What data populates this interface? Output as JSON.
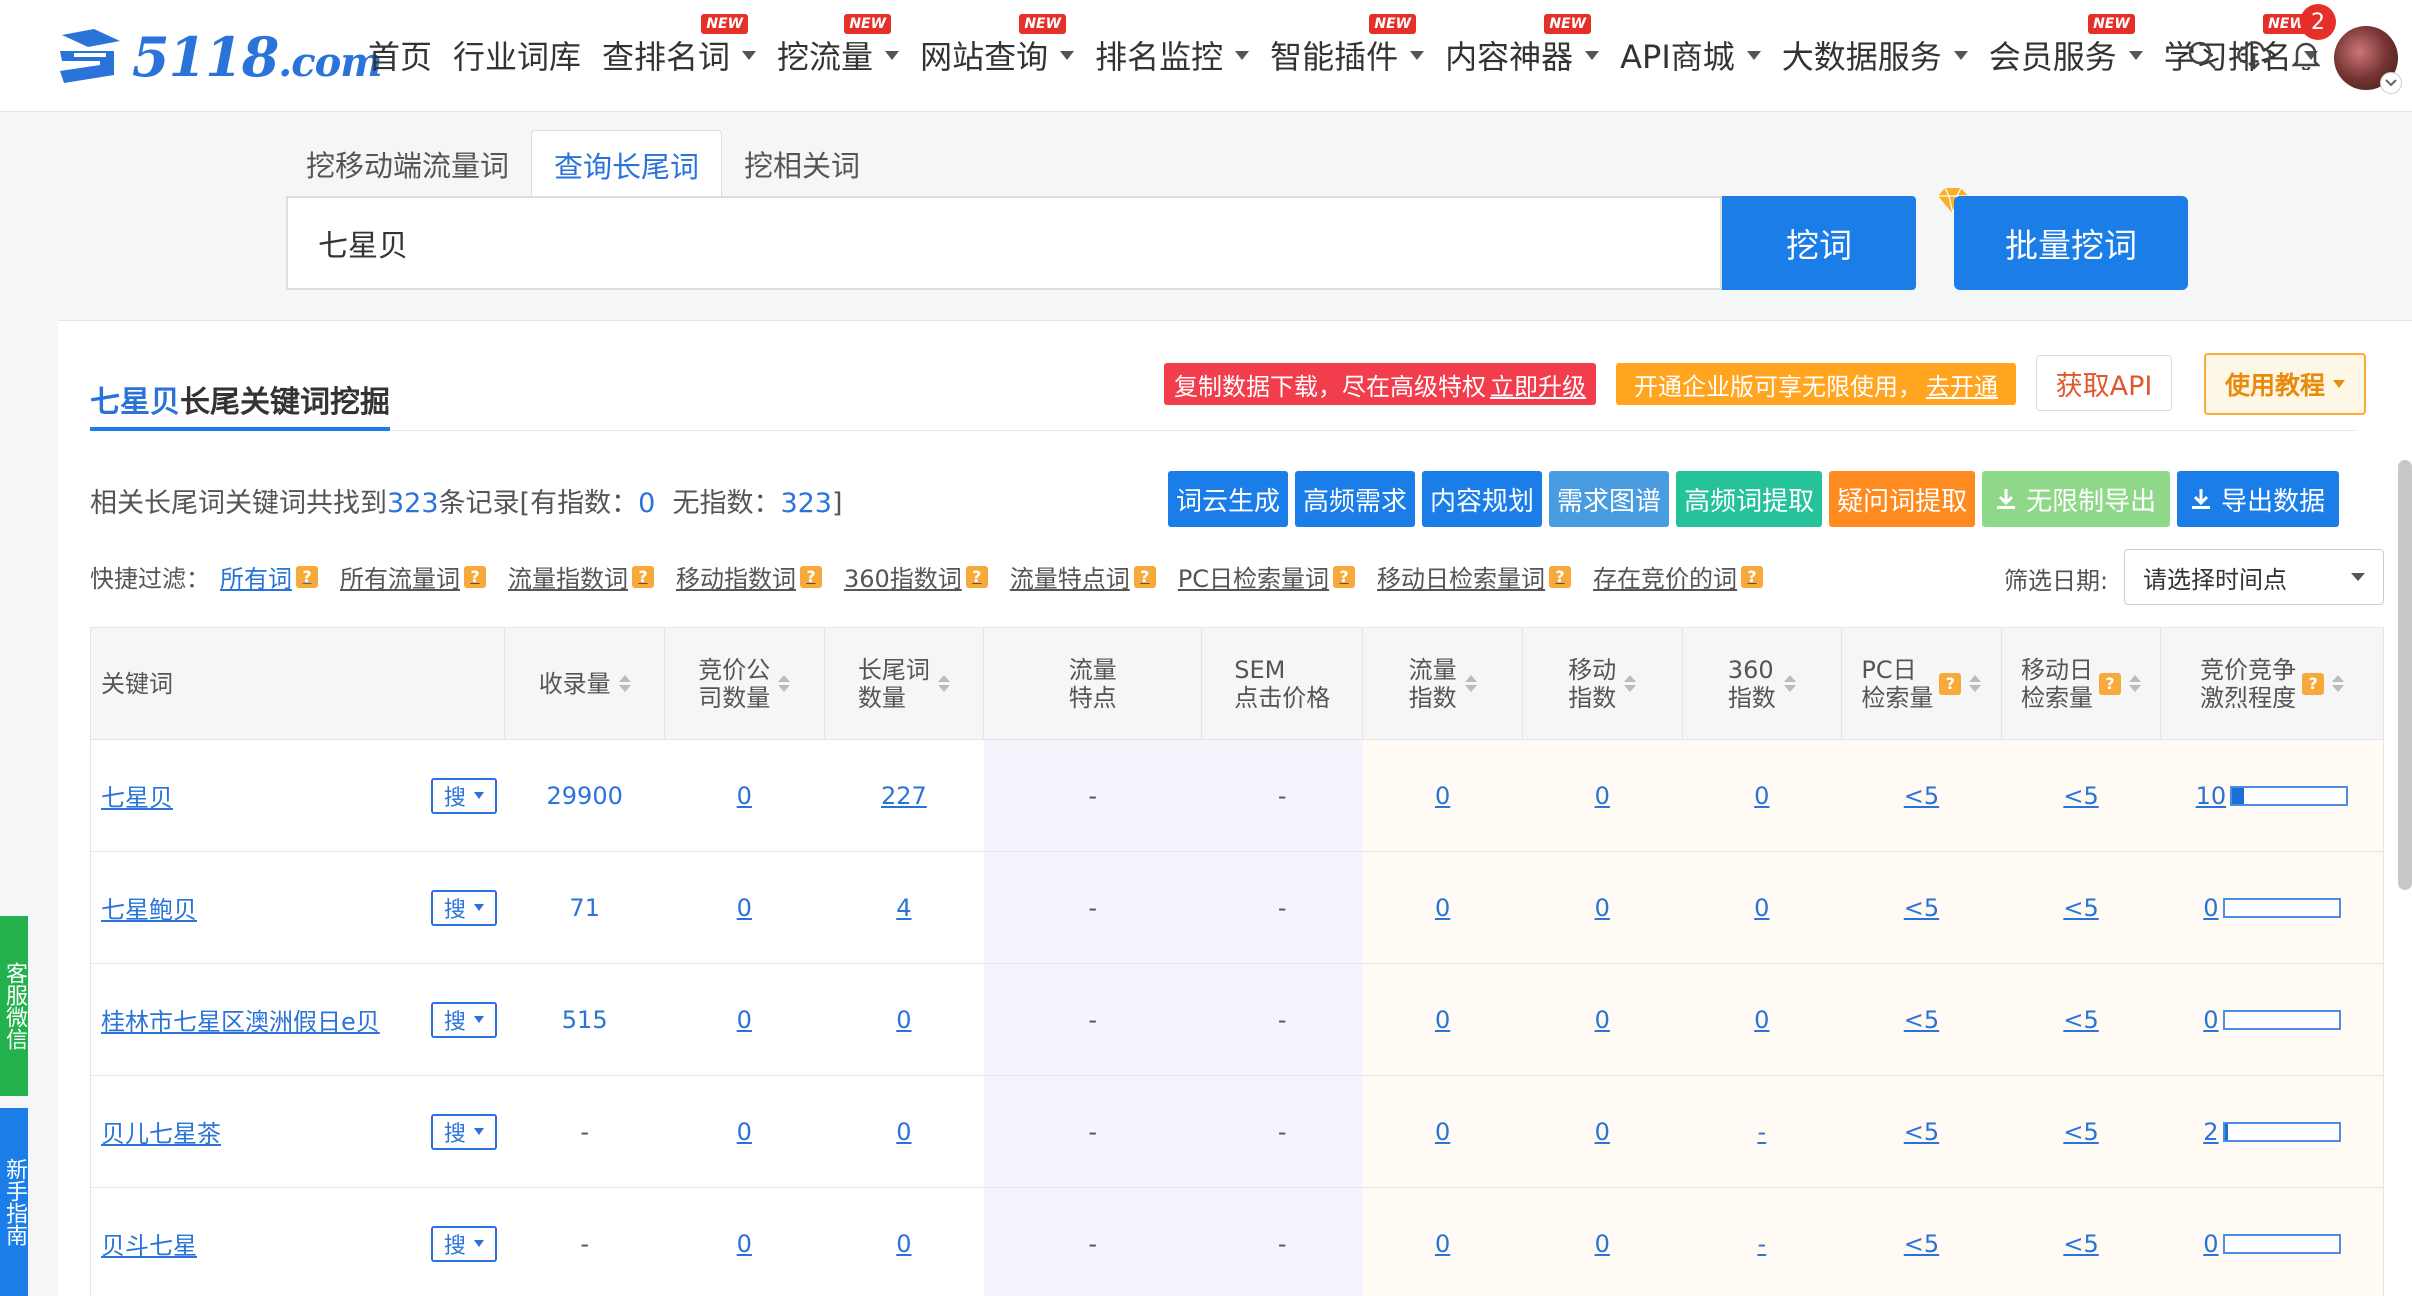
{
  "brand": {
    "logo_text": "5118",
    "logo_suffix": ".com",
    "accent": "#1a7de8"
  },
  "nav": {
    "items": [
      {
        "label": "首页",
        "dropdown": false,
        "new": false
      },
      {
        "label": "行业词库",
        "dropdown": false,
        "new": false
      },
      {
        "label": "查排名词",
        "dropdown": true,
        "new": true
      },
      {
        "label": "挖流量",
        "dropdown": true,
        "new": true
      },
      {
        "label": "网站查询",
        "dropdown": true,
        "new": true
      },
      {
        "label": "排名监控",
        "dropdown": true,
        "new": false
      },
      {
        "label": "智能插件",
        "dropdown": true,
        "new": true
      },
      {
        "label": "内容神器",
        "dropdown": true,
        "new": true
      },
      {
        "label": "API商城",
        "dropdown": true,
        "new": false
      },
      {
        "label": "大数据服务",
        "dropdown": true,
        "new": false
      },
      {
        "label": "会员服务",
        "dropdown": true,
        "new": true
      },
      {
        "label": "学习排名",
        "dropdown": true,
        "new": true
      }
    ],
    "new_tag": "NEW",
    "notification_count": "2"
  },
  "search": {
    "tabs": [
      "挖移动端流量词",
      "查询长尾词",
      "挖相关词"
    ],
    "active_tab": 1,
    "value": "七星贝",
    "dig_label": "挖词",
    "batch_label": "批量挖词"
  },
  "panel": {
    "title_keyword": "七星贝",
    "title_suffix": "长尾关键词挖掘",
    "promo_red": "复制数据下载，尽在高级特权",
    "promo_red_link": "立即升级",
    "promo_orange": "开通企业版可享无限使用，",
    "promo_orange_link": "去开通",
    "api_label": "获取API",
    "tutorial_label": "使用教程"
  },
  "summary": {
    "prefix": "相关长尾词关键词共找到",
    "total": "323",
    "mid": "条记录[有指数：",
    "with_index": "0",
    "mid2": "无指数：",
    "without_index": "323",
    "suffix": "]"
  },
  "tools": [
    "词云生成",
    "高频需求",
    "内容规划",
    "需求图谱",
    "高频词提取",
    "疑问词提取",
    "无限制导出",
    "导出数据"
  ],
  "quick_filter": {
    "label": "快捷过滤：",
    "items": [
      "所有词",
      "所有流量词",
      "流量指数词",
      "移动指数词",
      "360指数词",
      "流量特点词",
      "PC日检索量词",
      "移动日检索量词",
      "存在竞价的词"
    ]
  },
  "date_filter": {
    "label": "筛选日期:",
    "placeholder": "请选择时间点"
  },
  "table": {
    "headers": [
      "关键词",
      "收录量",
      "竞价公\n司数量",
      "长尾词\n数量",
      "流量\n特点",
      "SEM\n点击价格",
      "流量\n指数",
      "移动\n指数",
      "360\n指数",
      "PC日\n检索量",
      "移动日\n检索量",
      "竞价竞争\n激烈程度"
    ],
    "search_btn": "搜",
    "rows": [
      {
        "keyword": "七星贝",
        "indexed": "29900",
        "bid_companies": "0",
        "longtail": "227",
        "traffic": "-",
        "sem": "-",
        "flow_index": "0",
        "mobile_index": "0",
        "index360": "0",
        "pc_daily": "<5",
        "mobile_daily": "<5",
        "competition": "10",
        "competition_level": 0.1
      },
      {
        "keyword": "七星鲍贝",
        "indexed": "71",
        "bid_companies": "0",
        "longtail": "4",
        "traffic": "-",
        "sem": "-",
        "flow_index": "0",
        "mobile_index": "0",
        "index360": "0",
        "pc_daily": "<5",
        "mobile_daily": "<5",
        "competition": "0",
        "competition_level": 0
      },
      {
        "keyword": "桂林市七星区澳洲假日e贝",
        "indexed": "515",
        "bid_companies": "0",
        "longtail": "0",
        "traffic": "-",
        "sem": "-",
        "flow_index": "0",
        "mobile_index": "0",
        "index360": "0",
        "pc_daily": "<5",
        "mobile_daily": "<5",
        "competition": "0",
        "competition_level": 0
      },
      {
        "keyword": "贝儿七星茶",
        "indexed": "-",
        "bid_companies": "0",
        "longtail": "0",
        "traffic": "-",
        "sem": "-",
        "flow_index": "0",
        "mobile_index": "0",
        "index360": "-",
        "pc_daily": "<5",
        "mobile_daily": "<5",
        "competition": "2",
        "competition_level": 0.02
      },
      {
        "keyword": "贝斗七星",
        "indexed": "-",
        "bid_companies": "0",
        "longtail": "0",
        "traffic": "-",
        "sem": "-",
        "flow_index": "0",
        "mobile_index": "0",
        "index360": "-",
        "pc_daily": "<5",
        "mobile_daily": "<5",
        "competition": "0",
        "competition_level": 0
      }
    ]
  },
  "side": {
    "green_label": "客服微信",
    "blue_label": "新手指南"
  }
}
